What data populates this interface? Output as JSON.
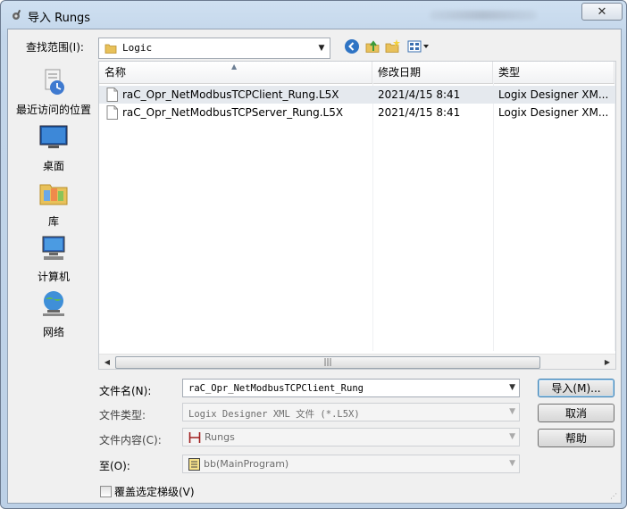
{
  "window": {
    "title": "导入 Rungs",
    "close_glyph": "✕"
  },
  "toolbar": {
    "lookin_label": "查找范围(I):",
    "lookin_value": "Logic",
    "icons": [
      "back-icon",
      "up-folder-icon",
      "new-folder-icon",
      "view-menu-icon"
    ]
  },
  "places": [
    {
      "label": "最近访问的位置",
      "icon": "recent-places-icon"
    },
    {
      "label": "桌面",
      "icon": "desktop-icon"
    },
    {
      "label": "库",
      "icon": "libraries-icon"
    },
    {
      "label": "计算机",
      "icon": "computer-icon"
    },
    {
      "label": "网络",
      "icon": "network-icon"
    }
  ],
  "filelist": {
    "columns": [
      "名称",
      "修改日期",
      "类型"
    ],
    "rows": [
      {
        "name": "raC_Opr_NetModbusTCPClient_Rung.L5X",
        "date": "2021/4/15 8:41",
        "type": "Logix Designer XM...",
        "selected": true
      },
      {
        "name": "raC_Opr_NetModbusTCPServer_Rung.L5X",
        "date": "2021/4/15 8:41",
        "type": "Logix Designer XM...",
        "selected": false
      }
    ],
    "scroll_thumb_glyph": "|||"
  },
  "form": {
    "filename_label": "文件名(N):",
    "filename_value": "raC_Opr_NetModbusTCPClient_Rung",
    "filetype_label": "文件类型:",
    "filetype_value": "Logix Designer XML 文件 (*.L5X)",
    "content_label": "文件内容(C):",
    "content_value": "Rungs",
    "to_label": "至(O):",
    "to_value": "bb(MainProgram)",
    "overwrite_label": "覆盖选定梯级(V)"
  },
  "buttons": {
    "import": "导入(M)...",
    "cancel": "取消",
    "help": "帮助"
  },
  "colors": {
    "titlebar": "#c3d6ea",
    "selection": "#e5e9ee",
    "default_button_border": "#3c7fb1"
  }
}
